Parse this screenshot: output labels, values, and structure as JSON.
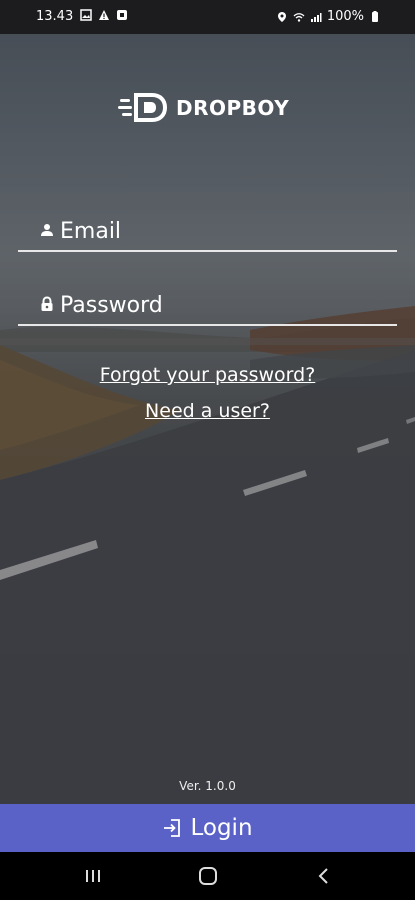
{
  "status_bar": {
    "time": "13.43",
    "battery": "100%",
    "icons": [
      "image-icon",
      "warning-icon",
      "app-icon",
      "location-icon",
      "wifi-icon",
      "signal-icon",
      "battery-icon"
    ]
  },
  "brand": {
    "name": "DROPBOY"
  },
  "form": {
    "email_placeholder": "Email",
    "password_placeholder": "Password",
    "forgot_link": "Forgot your password?",
    "need_user_link": "Need a user?"
  },
  "footer": {
    "version": "Ver. 1.0.0",
    "login_label": "Login"
  },
  "colors": {
    "login_button": "#5a62c8",
    "underline": "#e7e7e7"
  },
  "nav": [
    "recent-apps-icon",
    "home-icon",
    "back-icon"
  ]
}
